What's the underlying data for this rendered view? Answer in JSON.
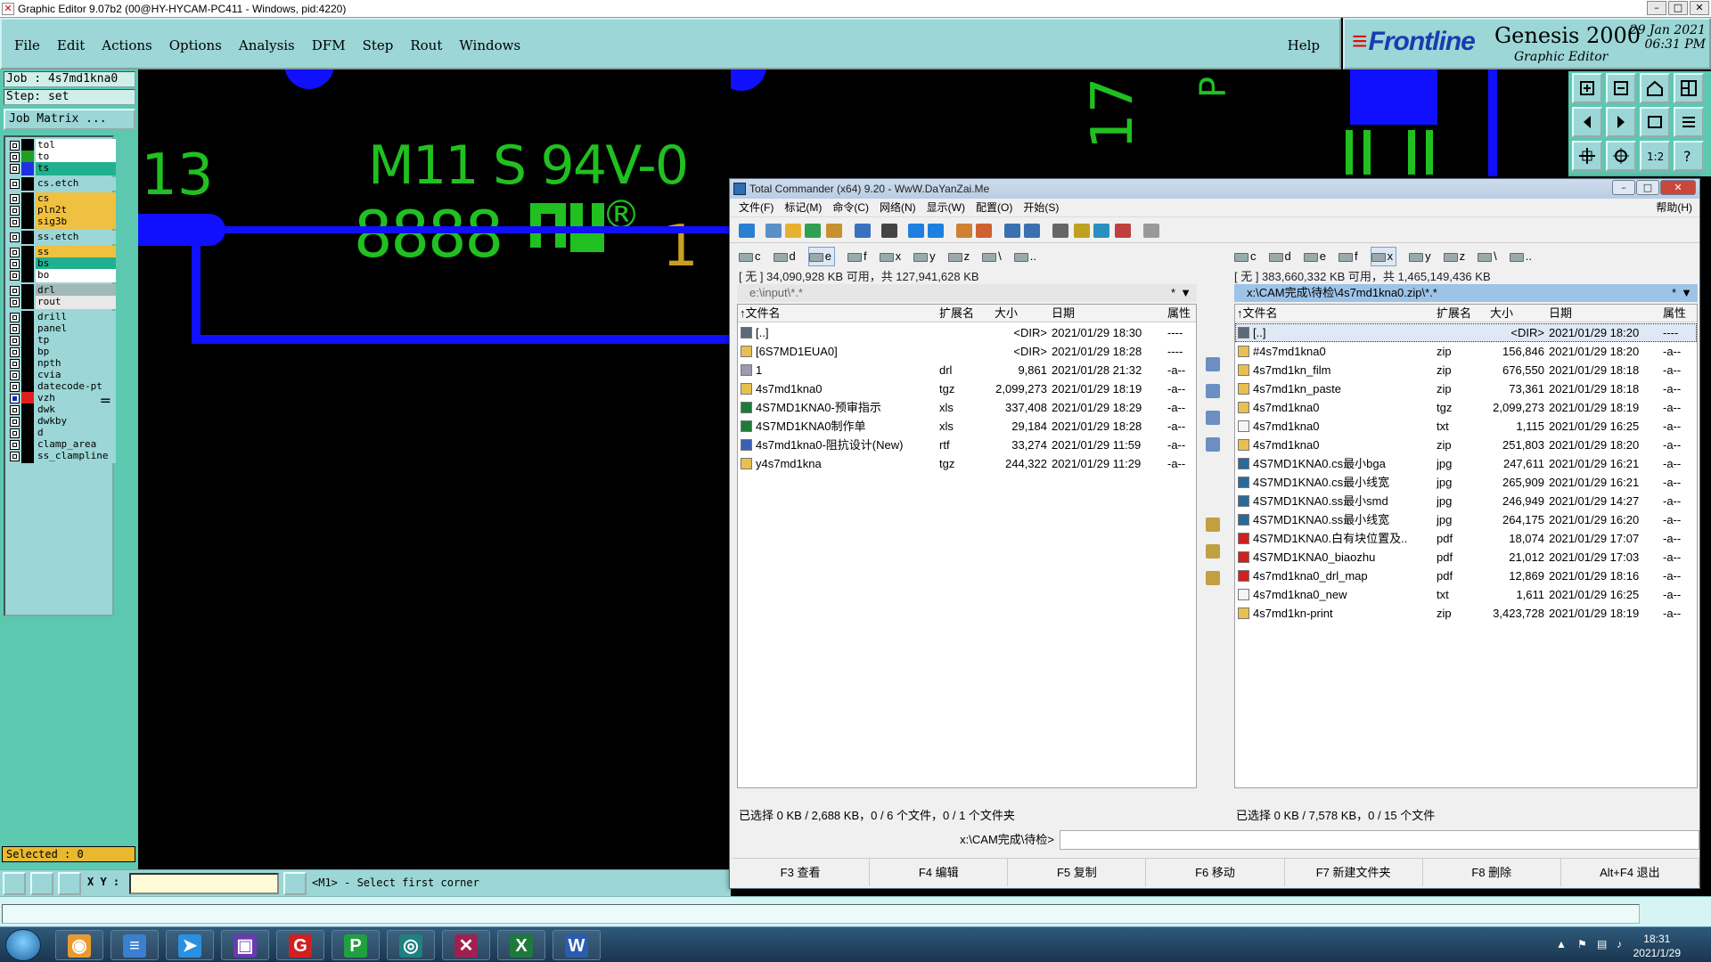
{
  "genesis": {
    "title": "Graphic Editor 9.07b2 (00@HY-HYCAM-PC411 - Windows, pid:4220)",
    "menu": [
      "File",
      "Edit",
      "Actions",
      "Options",
      "Analysis",
      "DFM",
      "Step",
      "Rout",
      "Windows"
    ],
    "help": "Help",
    "logo": {
      "brand": "Frontline",
      "product": "Genesis 2000",
      "subtitle": "Graphic Editor",
      "date": "29 Jan 2021",
      "time": "06:31 PM"
    },
    "job": "Job : 4s7md1kna0",
    "step": "Step: set",
    "job_matrix": "Job Matrix ...",
    "layers": [
      {
        "name": "tol",
        "color": "#ffffff",
        "swatch": "#000000",
        "cbox": false
      },
      {
        "name": "to",
        "color": "#ffffff",
        "swatch": "#20a020",
        "cbox": false
      },
      {
        "name": "ts",
        "color": "#20b090",
        "swatch": "#2030e0",
        "cbox": false
      },
      {
        "name": "cs.etch",
        "color": "#9cd6d6",
        "swatch": "#000000",
        "cbox": false,
        "gap": true
      },
      {
        "name": "cs",
        "color": "#f0c040",
        "swatch": "#000000",
        "cbox": false,
        "gap": true
      },
      {
        "name": "pln2t",
        "color": "#f0c040",
        "swatch": "#000000",
        "cbox": false
      },
      {
        "name": "sig3b",
        "color": "#f0c040",
        "swatch": "#000000",
        "cbox": false
      },
      {
        "name": "ss.etch",
        "color": "#9cd6d6",
        "swatch": "#000000",
        "cbox": false,
        "gap": true
      },
      {
        "name": "ss",
        "color": "#f0c040",
        "swatch": "#000000",
        "cbox": false,
        "gap": true
      },
      {
        "name": "bs",
        "color": "#20b090",
        "swatch": "#000000",
        "cbox": false
      },
      {
        "name": "bo",
        "color": "#ffffff",
        "swatch": "#000000",
        "cbox": false
      },
      {
        "name": "drl",
        "color": "#a0b8b8",
        "swatch": "#000000",
        "cbox": false,
        "gap": true
      },
      {
        "name": "rout",
        "color": "#e8e8e8",
        "swatch": "#000000",
        "cbox": false
      },
      {
        "name": "drill",
        "color": "#9cd6d6",
        "swatch": "#000000",
        "cbox": false,
        "gap": true
      },
      {
        "name": "panel",
        "color": "#9cd6d6",
        "swatch": "#000000",
        "cbox": false
      },
      {
        "name": "tp",
        "color": "#9cd6d6",
        "swatch": "#000000",
        "cbox": false
      },
      {
        "name": "bp",
        "color": "#9cd6d6",
        "swatch": "#000000",
        "cbox": false
      },
      {
        "name": "npth",
        "color": "#9cd6d6",
        "swatch": "#000000",
        "cbox": false
      },
      {
        "name": "cvia",
        "color": "#9cd6d6",
        "swatch": "#000000",
        "cbox": false
      },
      {
        "name": "datecode-pt",
        "color": "#9cd6d6",
        "swatch": "#000000",
        "cbox": false
      },
      {
        "name": "vzh",
        "color": "#9cd6d6",
        "swatch": "#e02020",
        "cbox": true,
        "mark": "="
      },
      {
        "name": "dwk",
        "color": "#9cd6d6",
        "swatch": "#000000",
        "cbox": false
      },
      {
        "name": "dwkby",
        "color": "#9cd6d6",
        "swatch": "#000000",
        "cbox": false
      },
      {
        "name": "d",
        "color": "#9cd6d6",
        "swatch": "#000000",
        "cbox": false
      },
      {
        "name": "clamp_area",
        "color": "#9cd6d6",
        "swatch": "#000000",
        "cbox": false
      },
      {
        "name": "ss_clampline",
        "color": "#9cd6d6",
        "swatch": "#000000",
        "cbox": false
      }
    ],
    "selected": "Selected : 0",
    "xy_label": "X Y :",
    "xy_value": "",
    "message": "<M1> - Select first corner",
    "canvas_text": {
      "h3": "-13",
      "marking": "M11 S 94V-0",
      "digits": "8888",
      "reg": "®",
      "one": "1",
      "right_num": "17",
      "p": "P"
    }
  },
  "tc": {
    "title": "Total Commander (x64) 9.20 - WwW.DaYanZai.Me",
    "menu": [
      "文件(F)",
      "标记(M)",
      "命令(C)",
      "网络(N)",
      "显示(W)",
      "配置(O)",
      "开始(S)"
    ],
    "help": "帮助(H)",
    "drives": [
      "c",
      "d",
      "e",
      "f",
      "x",
      "y",
      "z",
      "\\",
      ".."
    ],
    "left": {
      "selected_drive": "e",
      "free": "[ 无 ]  34,090,928 KB 可用，共 127,941,628 KB",
      "path": "e:\\input\\*.*",
      "star": "*",
      "arrow": "▼",
      "columns": [
        "↑文件名",
        "扩展名",
        "大小",
        "日期",
        "属性"
      ],
      "files": [
        {
          "name": "[..]",
          "ext": "",
          "size": "<DIR>",
          "date": "2021/01/29 18:30",
          "attr": "----",
          "kind": "up"
        },
        {
          "name": "[6S7MD1EUA0]",
          "ext": "",
          "size": "<DIR>",
          "date": "2021/01/29 18:28",
          "attr": "----",
          "kind": "dir"
        },
        {
          "name": "1",
          "ext": "drl",
          "size": "9,861",
          "date": "2021/01/28 21:32",
          "attr": "-a--",
          "kind": "file"
        },
        {
          "name": "4s7md1kna0",
          "ext": "tgz",
          "size": "2,099,273",
          "date": "2021/01/29 18:19",
          "attr": "-a--",
          "kind": "zip"
        },
        {
          "name": "4S7MD1KNA0-预审指示",
          "ext": "xls",
          "size": "337,408",
          "date": "2021/01/29 18:29",
          "attr": "-a--",
          "kind": "xls"
        },
        {
          "name": "4S7MD1KNA0制作单",
          "ext": "xls",
          "size": "29,184",
          "date": "2021/01/29 18:28",
          "attr": "-a--",
          "kind": "xls"
        },
        {
          "name": "4s7md1kna0-阻抗设计(New)",
          "ext": "rtf",
          "size": "33,274",
          "date": "2021/01/29 11:59",
          "attr": "-a--",
          "kind": "rtf"
        },
        {
          "name": "y4s7md1kna",
          "ext": "tgz",
          "size": "244,322",
          "date": "2021/01/29 11:29",
          "attr": "-a--",
          "kind": "zip"
        }
      ],
      "summary": "已选择 0 KB / 2,688 KB，0 / 6 个文件，0 / 1 个文件夹"
    },
    "right": {
      "selected_drive": "x",
      "free": "[ 无 ]  383,660,332 KB 可用，共 1,465,149,436 KB",
      "path": "x:\\CAM完成\\待检\\4s7md1kna0.zip\\*.*",
      "star": "*",
      "arrow": "▼",
      "columns": [
        "↑文件名",
        "扩展名",
        "大小",
        "日期",
        "属性"
      ],
      "files": [
        {
          "name": "[..]",
          "ext": "",
          "size": "<DIR>",
          "date": "2021/01/29 18:20",
          "attr": "----",
          "kind": "up"
        },
        {
          "name": "#4s7md1kna0",
          "ext": "zip",
          "size": "156,846",
          "date": "2021/01/29 18:20",
          "attr": "-a--",
          "kind": "zip"
        },
        {
          "name": "4s7md1kn_film",
          "ext": "zip",
          "size": "676,550",
          "date": "2021/01/29 18:18",
          "attr": "-a--",
          "kind": "zip"
        },
        {
          "name": "4s7md1kn_paste",
          "ext": "zip",
          "size": "73,361",
          "date": "2021/01/29 18:18",
          "attr": "-a--",
          "kind": "zip"
        },
        {
          "name": "4s7md1kna0",
          "ext": "tgz",
          "size": "2,099,273",
          "date": "2021/01/29 18:19",
          "attr": "-a--",
          "kind": "zip"
        },
        {
          "name": "4s7md1kna0",
          "ext": "txt",
          "size": "1,115",
          "date": "2021/01/29 16:25",
          "attr": "-a--",
          "kind": "txt"
        },
        {
          "name": "4s7md1kna0",
          "ext": "zip",
          "size": "251,803",
          "date": "2021/01/29 18:20",
          "attr": "-a--",
          "kind": "zip"
        },
        {
          "name": "4S7MD1KNA0.cs最小bga",
          "ext": "jpg",
          "size": "247,611",
          "date": "2021/01/29 16:21",
          "attr": "-a--",
          "kind": "jpg"
        },
        {
          "name": "4S7MD1KNA0.cs最小线宽",
          "ext": "jpg",
          "size": "265,909",
          "date": "2021/01/29 16:21",
          "attr": "-a--",
          "kind": "jpg"
        },
        {
          "name": "4S7MD1KNA0.ss最小smd",
          "ext": "jpg",
          "size": "246,949",
          "date": "2021/01/29 14:27",
          "attr": "-a--",
          "kind": "jpg"
        },
        {
          "name": "4S7MD1KNA0.ss最小线宽",
          "ext": "jpg",
          "size": "264,175",
          "date": "2021/01/29 16:20",
          "attr": "-a--",
          "kind": "jpg"
        },
        {
          "name": "4S7MD1KNA0.白有块位置及..",
          "ext": "pdf",
          "size": "18,074",
          "date": "2021/01/29 17:07",
          "attr": "-a--",
          "kind": "pdf"
        },
        {
          "name": "4S7MD1KNA0_biaozhu",
          "ext": "pdf",
          "size": "21,012",
          "date": "2021/01/29 17:03",
          "attr": "-a--",
          "kind": "pdf"
        },
        {
          "name": "4s7md1kna0_drl_map",
          "ext": "pdf",
          "size": "12,869",
          "date": "2021/01/29 18:16",
          "attr": "-a--",
          "kind": "pdf"
        },
        {
          "name": "4s7md1kna0_new",
          "ext": "txt",
          "size": "1,611",
          "date": "2021/01/29 16:25",
          "attr": "-a--",
          "kind": "txt"
        },
        {
          "name": "4s7md1kn-print",
          "ext": "zip",
          "size": "3,423,728",
          "date": "2021/01/29 18:19",
          "attr": "-a--",
          "kind": "zip"
        }
      ],
      "summary": "已选择 0 KB / 7,578 KB，0 / 15 个文件"
    },
    "cmd_label": "x:\\CAM完成\\待检>",
    "cmd_value": "",
    "fkeys": [
      "F3 查看",
      "F4 编辑",
      "F5 复制",
      "F6 移动",
      "F7 新建文件夹",
      "F8 删除",
      "Alt+F4 退出"
    ]
  },
  "taskbar": {
    "apps": [
      {
        "name": "browser",
        "glyph": "◉",
        "color": "#e89a30"
      },
      {
        "name": "notepad",
        "glyph": "≡",
        "color": "#3a7fd0"
      },
      {
        "name": "messenger",
        "glyph": "➤",
        "color": "#2a90e0"
      },
      {
        "name": "save",
        "glyph": "▣",
        "color": "#6a3ab0"
      },
      {
        "name": "app-g",
        "glyph": "G",
        "color": "#d02020"
      },
      {
        "name": "app-p",
        "glyph": "P",
        "color": "#20a040"
      },
      {
        "name": "viewer",
        "glyph": "◎",
        "color": "#208080"
      },
      {
        "name": "genesis",
        "glyph": "✕",
        "color": "#a02050"
      },
      {
        "name": "excel",
        "glyph": "X",
        "color": "#1d7a3a"
      },
      {
        "name": "word",
        "glyph": "W",
        "color": "#2a5cb0"
      }
    ],
    "time": "18:31",
    "date": "2021/1/29"
  }
}
